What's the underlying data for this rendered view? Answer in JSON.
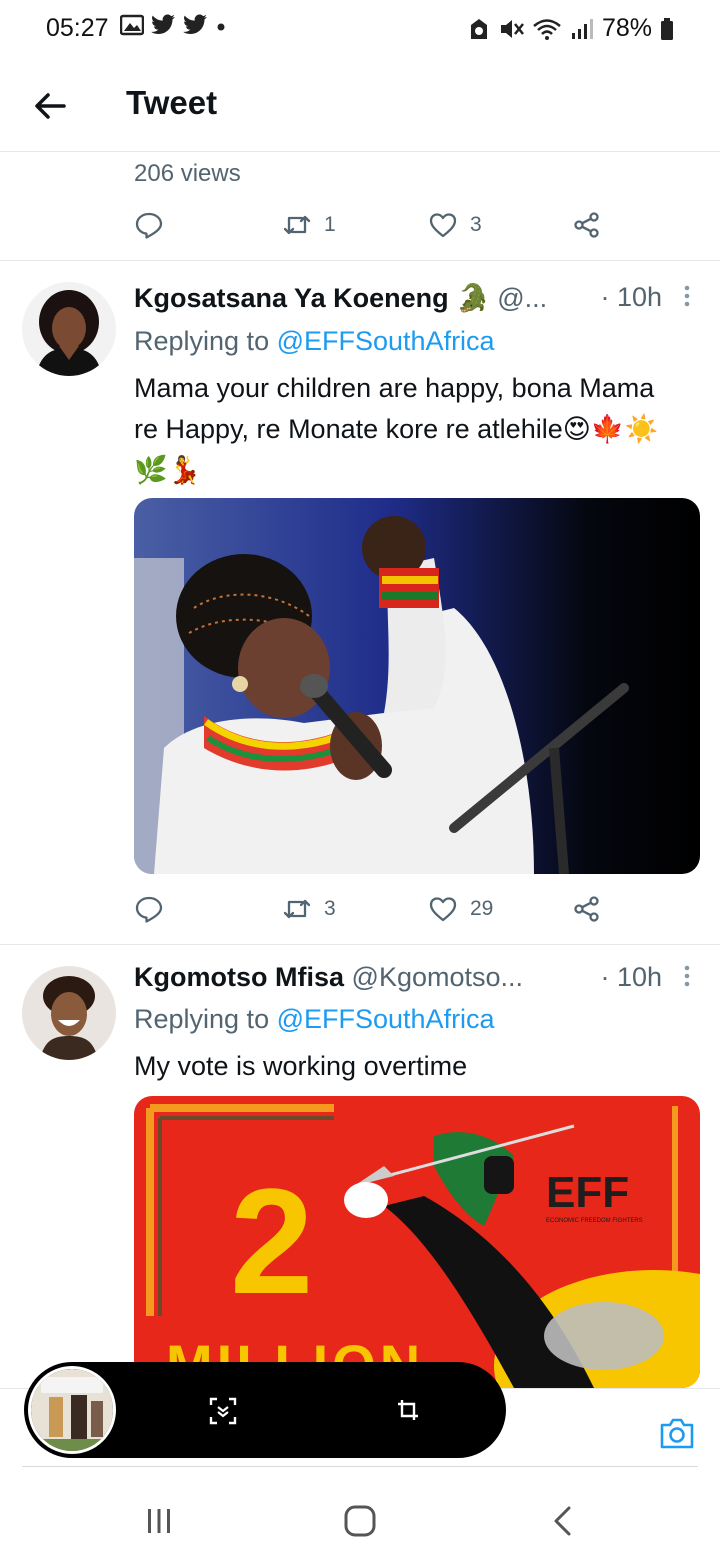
{
  "status_bar": {
    "time": "05:27",
    "left_icons": [
      "gallery-icon",
      "twitter-icon",
      "twitter-icon",
      "dot-icon"
    ],
    "right_icons": [
      "alarm-icon",
      "mute-icon",
      "wifi-icon",
      "signal-icon"
    ],
    "battery": "78%"
  },
  "header": {
    "title": "Tweet"
  },
  "main_tweet": {
    "views": "206 views",
    "retweets": "1",
    "likes": "3"
  },
  "replies": [
    {
      "name": "Kgosatsana Ya Koeneng",
      "name_emoji": "🐊",
      "handle": "@...",
      "time": "· 10h",
      "replying_prefix": "Replying to ",
      "replying_to": "@EFFSouthAfrica",
      "text": "Mama your children are happy, bona Mama re Happy, re Monate kore re atlehile😍🍁☀️🌿💃",
      "retweets": "3",
      "likes": "29"
    },
    {
      "name": "Kgomotso Mfisa",
      "handle": "@Kgomotso...",
      "time": "· 10h",
      "replying_prefix": "Replying to ",
      "replying_to": "@EFFSouthAfrica",
      "text": "My vote is working overtime",
      "poster": {
        "number": "2",
        "word": "MILLION",
        "brand": "EFF",
        "brand_sub": "ECONOMIC FREEDOM FIGHTERS"
      }
    }
  ],
  "colors": {
    "accent": "#1d9bf0",
    "secondary_text": "#536471",
    "poster_red": "#e8271b",
    "poster_yellow": "#f7c600"
  }
}
